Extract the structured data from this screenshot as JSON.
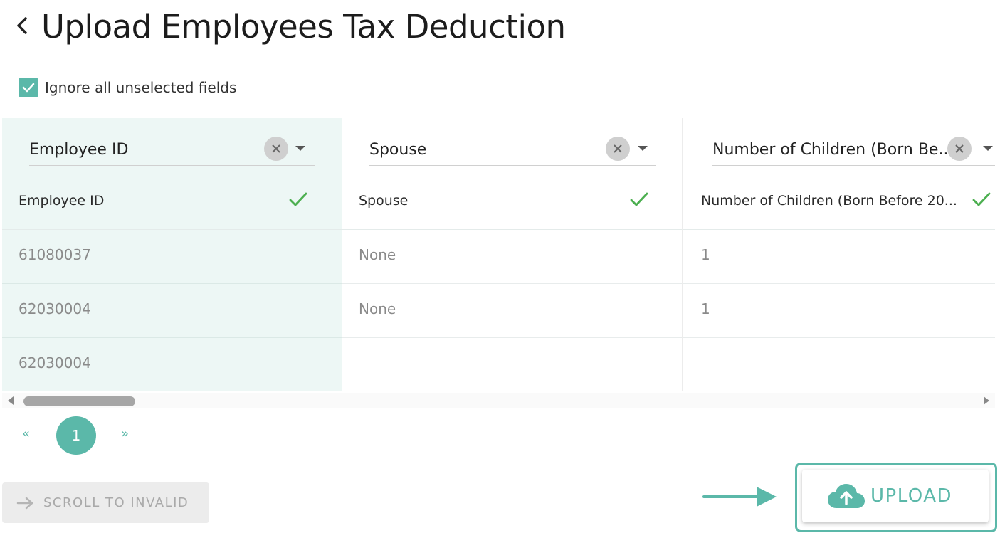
{
  "page": {
    "title": "Upload Employees Tax Deduction",
    "back_icon": "chevron-left-icon"
  },
  "options": {
    "ignore_unselected_label": "Ignore all unselected fields",
    "ignore_unselected_checked": true
  },
  "columns": [
    {
      "selected_field": "Employee ID",
      "header": "Employee ID",
      "valid": true,
      "cells": [
        "61080037",
        "62030004",
        "62030004"
      ]
    },
    {
      "selected_field": "Spouse",
      "header": "Spouse",
      "valid": true,
      "cells": [
        "None",
        "None",
        ""
      ]
    },
    {
      "selected_field": "Number of Children (Born Be...",
      "header": "Number of Children (Born Before 20...",
      "valid": true,
      "cells": [
        "1",
        "1",
        ""
      ]
    }
  ],
  "pagination": {
    "prev": "«",
    "current": "1",
    "next": "»"
  },
  "actions": {
    "scroll_to_invalid": "SCROLL TO INVALID",
    "upload": "UPLOAD"
  },
  "colors": {
    "accent": "#5bb8a9",
    "selected_column_bg": "#edf7f5",
    "valid_check": "#4caf50",
    "disabled_bg": "#ececec"
  }
}
